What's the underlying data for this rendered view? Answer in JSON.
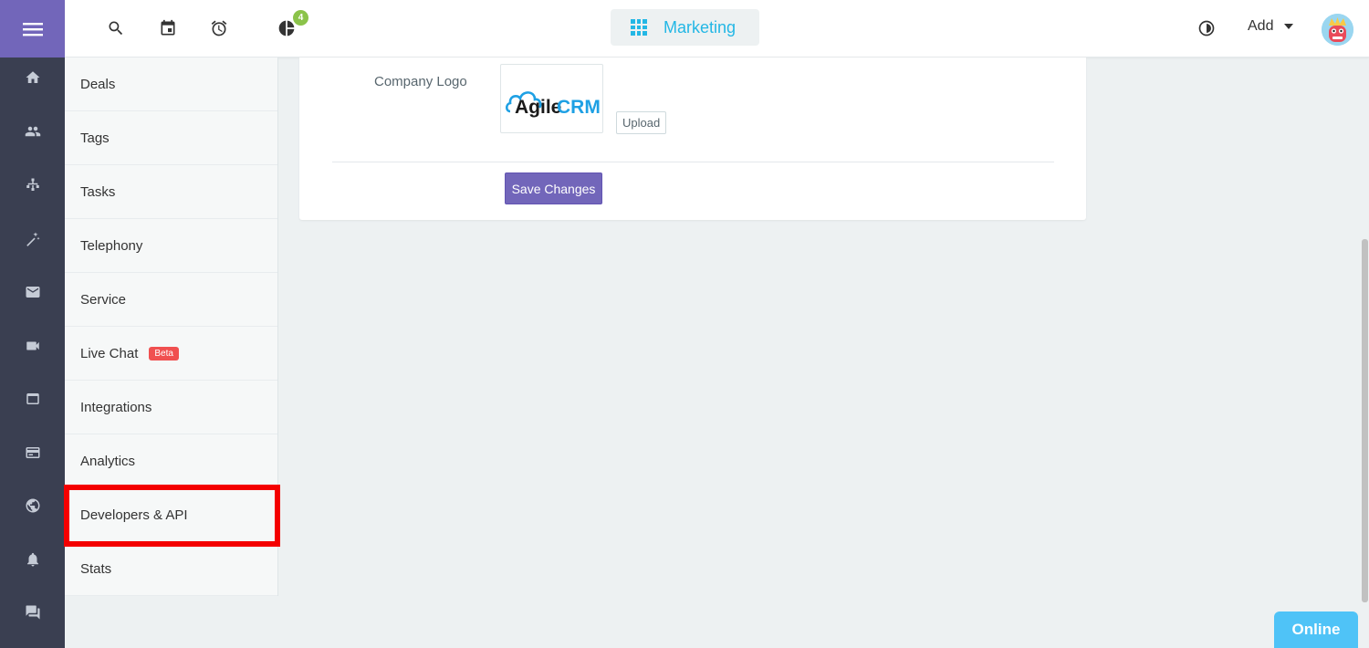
{
  "header": {
    "notification_count": "4",
    "module_label": "Marketing",
    "add_label": "Add"
  },
  "sidebar": {
    "items": [
      {
        "label": "Deals"
      },
      {
        "label": "Tags"
      },
      {
        "label": "Tasks"
      },
      {
        "label": "Telephony"
      },
      {
        "label": "Service"
      },
      {
        "label": "Live Chat",
        "badge": "Beta"
      },
      {
        "label": "Integrations"
      },
      {
        "label": "Analytics"
      },
      {
        "label": "Developers & API"
      },
      {
        "label": "Stats"
      }
    ]
  },
  "rail": {
    "icons": [
      "menu-icon",
      "home-icon",
      "contacts-icon",
      "hierarchy-icon",
      "magic-wand-icon",
      "mail-icon",
      "video-icon",
      "window-icon",
      "card-icon",
      "globe-icon",
      "bell-icon",
      "chat-icon"
    ]
  },
  "main": {
    "logo_label": "Company Logo",
    "logo_text_agile": "Agile",
    "logo_text_crm": "CRM",
    "upload_label": "Upload",
    "save_label": "Save Changes"
  },
  "widget": {
    "online_label": "Online"
  },
  "colors": {
    "primary": "#7266ba",
    "accent": "#23b7e5",
    "highlight": "#f40000",
    "badge_beta": "#f05050",
    "badge_count": "#8bc34a"
  }
}
